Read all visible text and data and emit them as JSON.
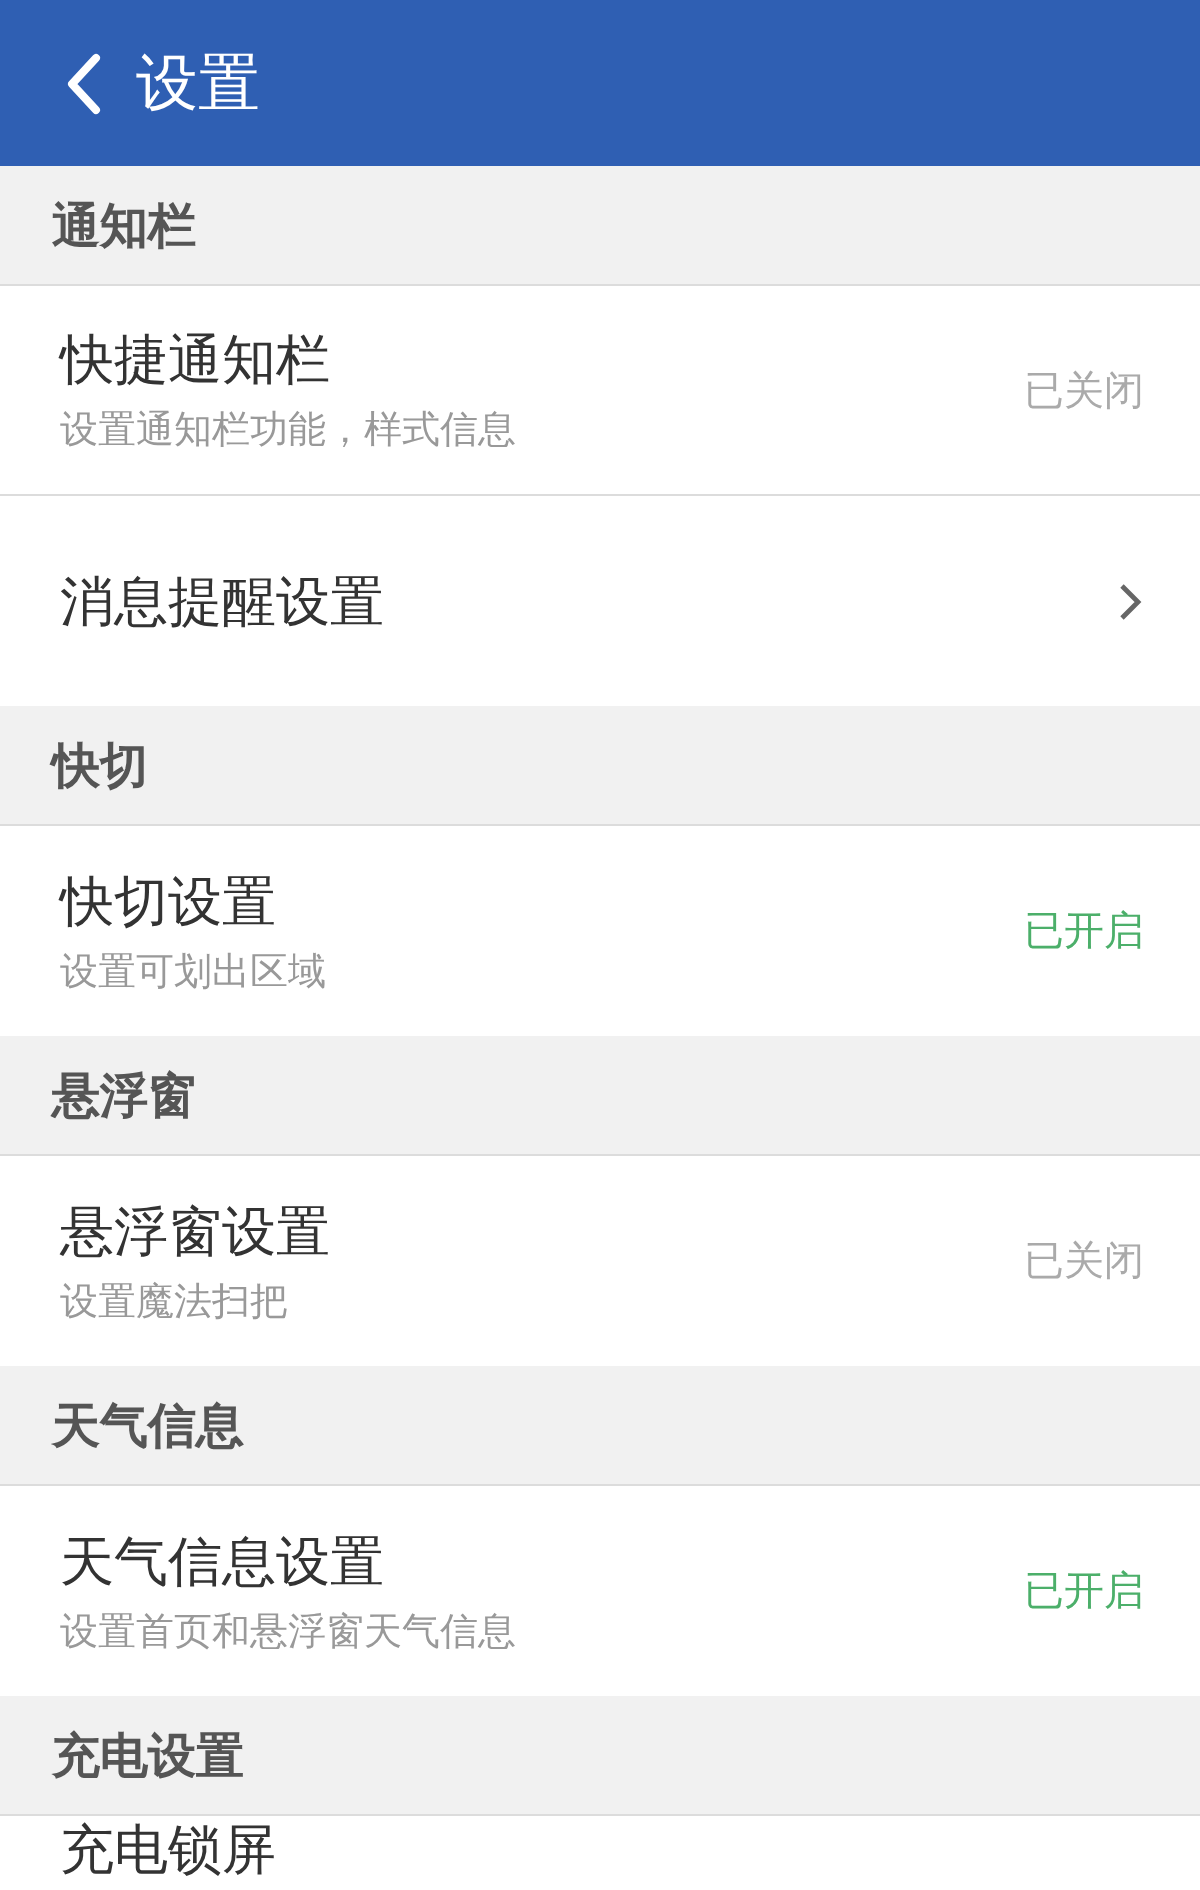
{
  "header": {
    "title": "设置"
  },
  "sections": [
    {
      "title": "通知栏",
      "items": [
        {
          "kind": "status",
          "title": "快捷通知栏",
          "subtitle": "设置通知栏功能，样式信息",
          "status": "已关闭",
          "on": false
        },
        {
          "kind": "link",
          "title": "消息提醒设置"
        }
      ]
    },
    {
      "title": "快切",
      "items": [
        {
          "kind": "status",
          "title": "快切设置",
          "subtitle": "设置可划出区域",
          "status": "已开启",
          "on": true
        }
      ]
    },
    {
      "title": "悬浮窗",
      "items": [
        {
          "kind": "status",
          "title": "悬浮窗设置",
          "subtitle": "设置魔法扫把",
          "status": "已关闭",
          "on": false
        }
      ]
    },
    {
      "title": "天气信息",
      "items": [
        {
          "kind": "status",
          "title": "天气信息设置",
          "subtitle": "设置首页和悬浮窗天气信息",
          "status": "已开启",
          "on": true
        }
      ]
    },
    {
      "title": "充电设置",
      "items": [
        {
          "kind": "plain",
          "title": "充电锁屏"
        }
      ]
    }
  ]
}
